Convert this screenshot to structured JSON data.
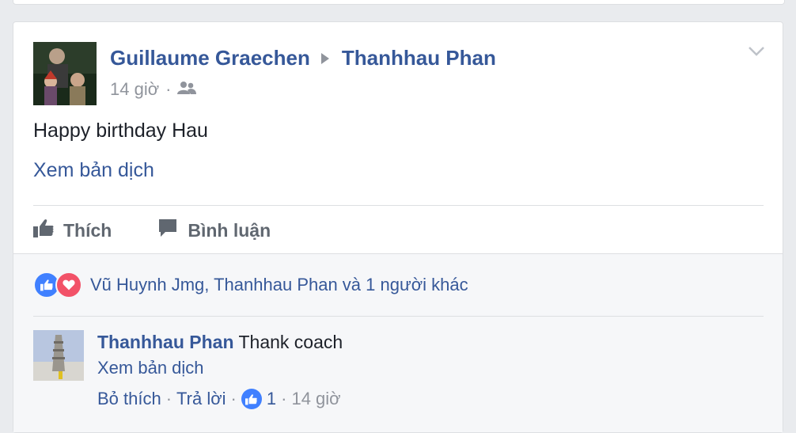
{
  "post": {
    "author": "Guillaume Graechen",
    "target": "Thanhhau Phan",
    "time": "14 giờ",
    "audience_icon": "friends-icon",
    "text": "Happy birthday Hau",
    "see_translation": "Xem bản dịch",
    "actions": {
      "like": "Thích",
      "comment": "Bình luận"
    }
  },
  "reactions": {
    "icons": [
      "like-icon",
      "love-icon"
    ],
    "summary": "Vũ Huynh Jmg, Thanhhau Phan và 1 người khác"
  },
  "comment": {
    "author": "Thanhhau Phan",
    "text": "Thank coach",
    "see_translation": "Xem bản dịch",
    "unlike": "Bỏ thích",
    "reply": "Trả lời",
    "like_count": "1",
    "time": "14 giờ"
  },
  "colors": {
    "link": "#365899",
    "like_blue": "#4080ff",
    "love_red": "#f25268",
    "muted": "#90949c"
  }
}
